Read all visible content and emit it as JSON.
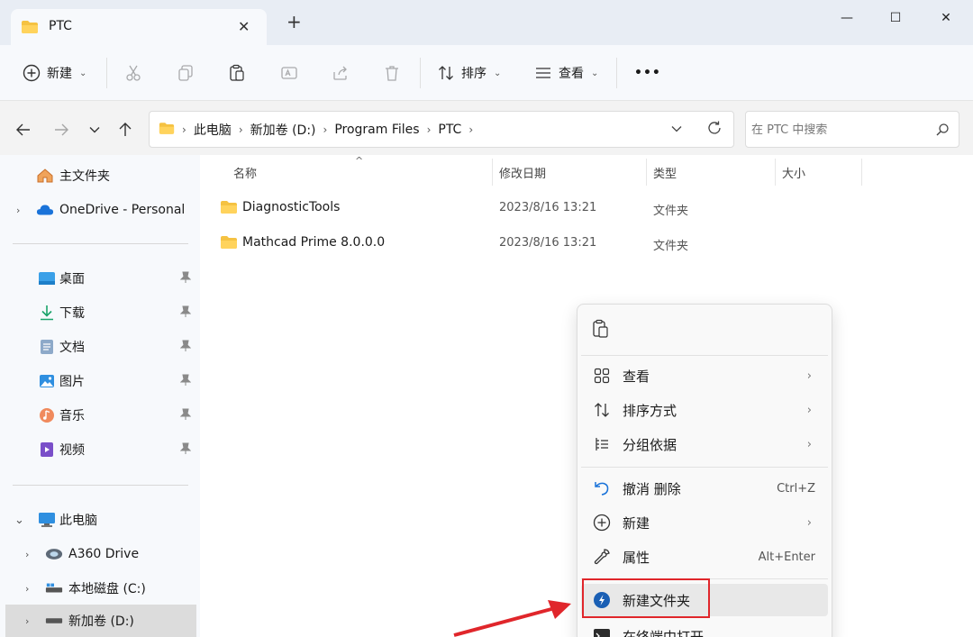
{
  "tab": {
    "title": "PTC",
    "close": "✕",
    "add": "+"
  },
  "window": {
    "minimize": "—",
    "maximize": "☐",
    "close": "✕"
  },
  "toolbar": {
    "new_label": "新建",
    "sort_label": "排序",
    "view_label": "查看",
    "more_label": "•••"
  },
  "address": {
    "crumbs": [
      "此电脑",
      "新加卷 (D:)",
      "Program Files",
      "PTC"
    ],
    "search_placeholder": "在 PTC 中搜索"
  },
  "sidebar": {
    "home": "主文件夹",
    "onedrive": "OneDrive - Personal",
    "pinned": [
      "桌面",
      "下载",
      "文档",
      "图片",
      "音乐",
      "视频"
    ],
    "thispc": "此电脑",
    "drives": [
      "A360 Drive",
      "本地磁盘 (C:)",
      "新加卷 (D:)"
    ]
  },
  "columns": {
    "name": "名称",
    "date": "修改日期",
    "type": "类型",
    "size": "大小"
  },
  "files": [
    {
      "name": "DiagnosticTools",
      "date": "2023/8/16 13:21",
      "type": "文件夹"
    },
    {
      "name": "Mathcad Prime 8.0.0.0",
      "date": "2023/8/16 13:21",
      "type": "文件夹"
    }
  ],
  "context_menu": {
    "view": "查看",
    "sort": "排序方式",
    "group": "分组依据",
    "undo": "撤消 删除",
    "undo_shortcut": "Ctrl+Z",
    "new": "新建",
    "properties": "属性",
    "properties_shortcut": "Alt+Enter",
    "new_folder": "新建文件夹",
    "terminal": "在终端中打开"
  },
  "colors": {
    "accent": "#0067c0",
    "highlight": "#e0262b",
    "folder": "#f5c242"
  }
}
